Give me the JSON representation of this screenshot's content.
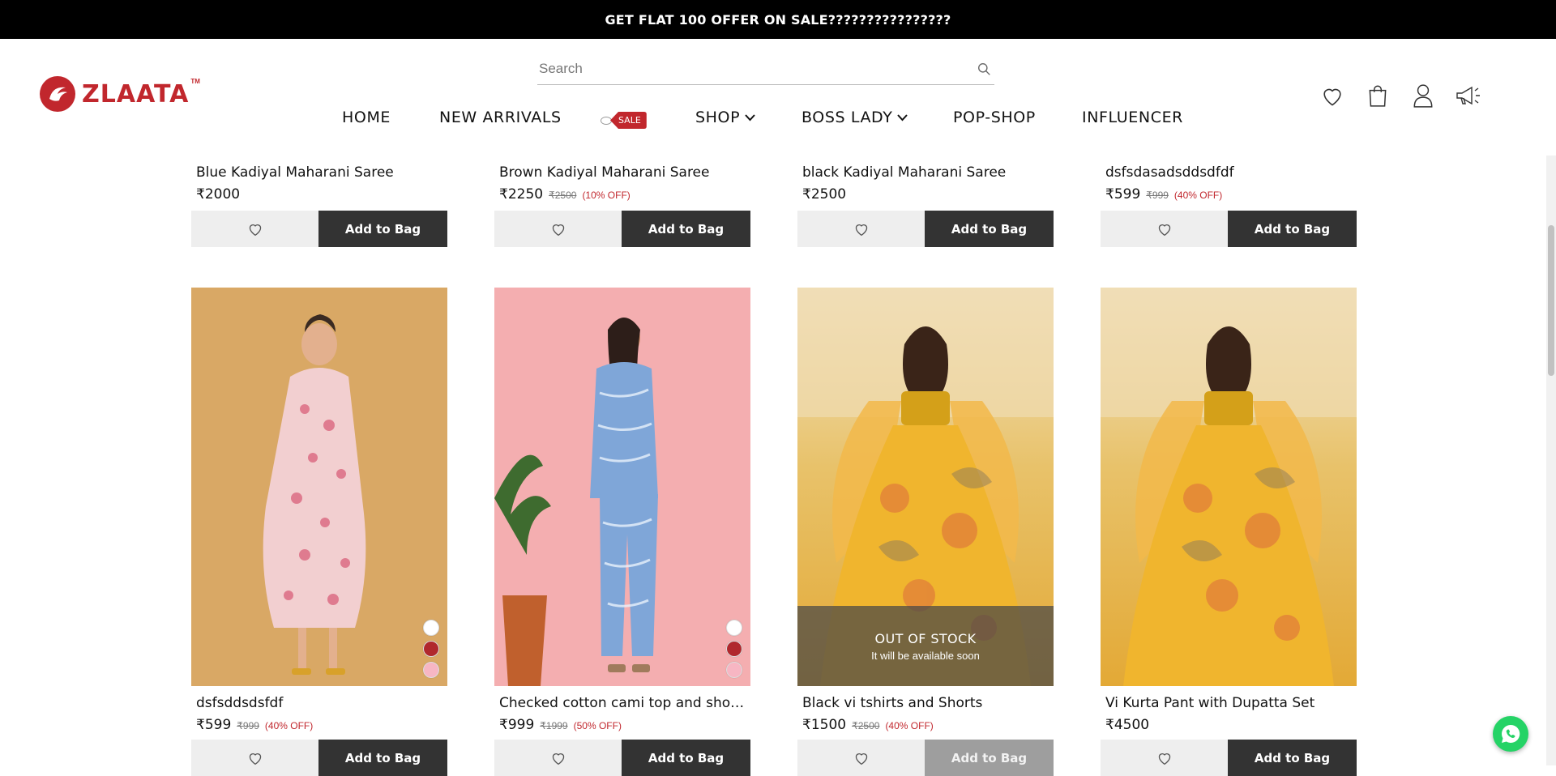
{
  "announcement": "GET FLAT 100 OFFER ON SALE????????????????",
  "brand": {
    "name": "ZLAATA",
    "tm": "TM",
    "color": "#c1272d"
  },
  "search": {
    "placeholder": "Search",
    "icon": "search-icon"
  },
  "nav": {
    "items": [
      {
        "label": "HOME"
      },
      {
        "label": "NEW ARRIVALS"
      },
      {
        "label": "SHOP",
        "dropdown": true
      },
      {
        "label": "BOSS LADY",
        "dropdown": true
      },
      {
        "label": "POP-SHOP"
      },
      {
        "label": "INFLUENCER"
      }
    ],
    "sale_tag": "SALE"
  },
  "header_icons": [
    "heart-icon",
    "bag-icon",
    "user-icon",
    "megaphone-icon"
  ],
  "products_row1": [
    {
      "name": "Blue Kadiyal Maharani Saree",
      "price": "₹2000",
      "mrp": "",
      "off": "",
      "button": "Add to Bag"
    },
    {
      "name": "Brown Kadiyal Maharani Saree",
      "price": "₹2250",
      "mrp": "₹2500",
      "off": "(10% OFF)",
      "button": "Add to Bag"
    },
    {
      "name": "black Kadiyal Maharani Saree",
      "price": "₹2500",
      "mrp": "",
      "off": "",
      "button": "Add to Bag"
    },
    {
      "name": "dsfsdasadsddsdfdf",
      "price": "₹599",
      "mrp": "₹999",
      "off": "(40% OFF)",
      "button": "Add to Bag"
    }
  ],
  "products_row2": [
    {
      "name": "dsfsddsdsfdf",
      "price": "₹599",
      "mrp": "₹999",
      "off": "(40% OFF)",
      "button": "Add to Bag",
      "swatches": [
        "#ffffff",
        "#b0282d",
        "#f7b6c3"
      ]
    },
    {
      "name": "Checked cotton cami top and shorts...",
      "price": "₹999",
      "mrp": "₹1999",
      "off": "(50% OFF)",
      "button": "Add to Bag",
      "swatches": [
        "#ffffff",
        "#b0282d",
        "#f7b6c3"
      ]
    },
    {
      "name": "Black vi tshirts and Shorts",
      "price": "₹1500",
      "mrp": "₹2500",
      "off": "(40% OFF)",
      "button": "Add to Bag",
      "out_of_stock": "OUT OF STOCK",
      "availability": "It will be available soon"
    },
    {
      "name": "Vi Kurta Pant with Dupatta Set",
      "price": "₹4500",
      "mrp": "",
      "off": "",
      "button": "Add to Bag"
    }
  ]
}
